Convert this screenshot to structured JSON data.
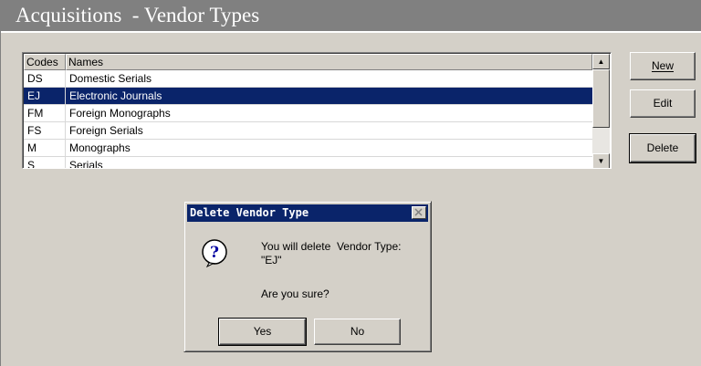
{
  "window": {
    "title": "Acquisitions  - Vendor Types"
  },
  "list": {
    "headers": {
      "codes": "Codes",
      "names": "Names"
    },
    "rows": [
      {
        "code": "DS",
        "name": "Domestic Serials"
      },
      {
        "code": "EJ",
        "name": "Electronic Journals"
      },
      {
        "code": "FM",
        "name": "Foreign Monographs"
      },
      {
        "code": "FS",
        "name": "Foreign Serials"
      },
      {
        "code": "M",
        "name": "Monographs"
      },
      {
        "code": "S",
        "name": "Serials"
      }
    ],
    "selected_code": "EJ"
  },
  "buttons": {
    "new": "New",
    "edit": "Edit",
    "delete": "Delete"
  },
  "dialog": {
    "title": "Delete Vendor Type",
    "message_line1": "You will delete  Vendor Type:",
    "message_line2": "\"EJ\"",
    "question": "Are you sure?",
    "yes": "Yes",
    "no": "No",
    "icon": "question-icon"
  },
  "colors": {
    "selection": "#0a246a",
    "title_bar": "#808080",
    "face": "#d4d0c8"
  }
}
